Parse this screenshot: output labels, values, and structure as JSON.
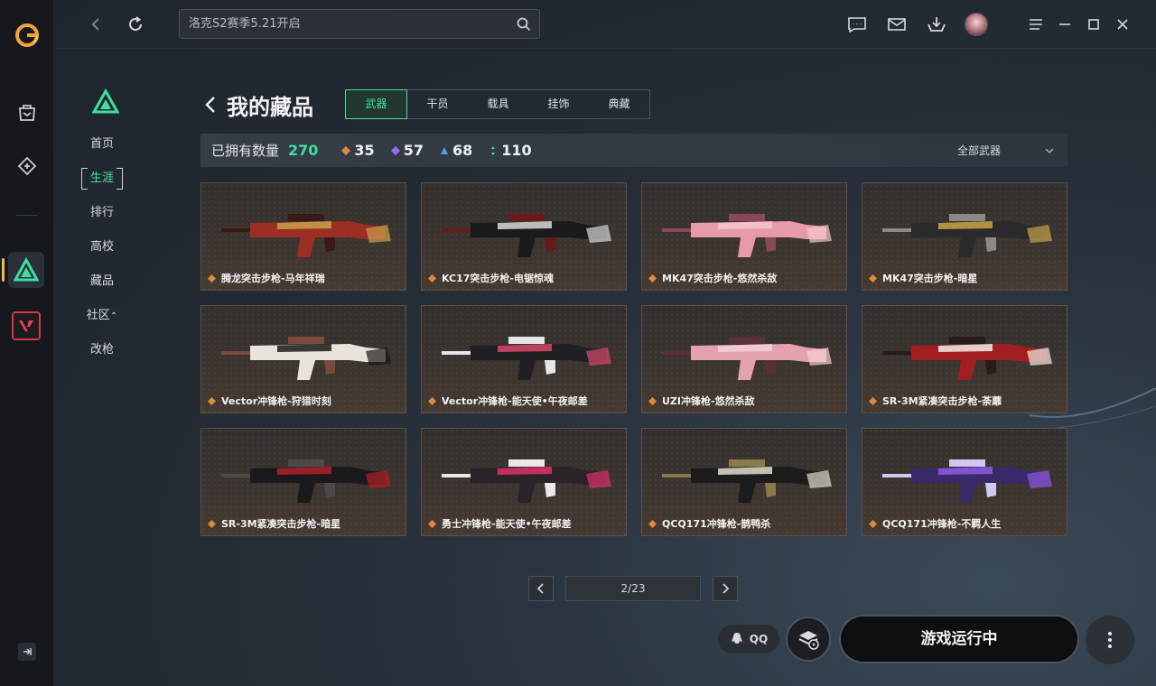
{
  "search": {
    "placeholder": "洛克S2赛季5.21开启"
  },
  "nav": {
    "items": [
      {
        "label": "首页",
        "active": false
      },
      {
        "label": "生涯",
        "active": true
      },
      {
        "label": "排行",
        "active": false
      },
      {
        "label": "高校",
        "active": false
      },
      {
        "label": "藏品",
        "active": false
      },
      {
        "label": "社区",
        "active": false
      },
      {
        "label": "改枪",
        "active": false
      }
    ]
  },
  "header": {
    "title": "我的藏品"
  },
  "tabs": [
    {
      "label": "武器",
      "active": true
    },
    {
      "label": "干员",
      "active": false
    },
    {
      "label": "载具",
      "active": false
    },
    {
      "label": "挂饰",
      "active": false
    },
    {
      "label": "典藏",
      "active": false
    }
  ],
  "stats": {
    "owned_label": "已拥有数量",
    "owned_total": "270",
    "tiers": [
      {
        "value": "35",
        "color": "#e08a3c"
      },
      {
        "value": "57",
        "color": "#9a6cf0"
      },
      {
        "value": "68",
        "color": "#4aa3f0"
      },
      {
        "value": "110",
        "color": "#3ee0a0"
      }
    ],
    "filter_label": "全部武器"
  },
  "items": [
    {
      "name": "腾龙突击步枪-马年祥瑞",
      "colors": [
        "#9c2e24",
        "#c9a14a",
        "#3a1a16"
      ]
    },
    {
      "name": "KC17突击步枪-电锯惊魂",
      "colors": [
        "#1b1b1d",
        "#d8d8d8",
        "#6a1a1a"
      ]
    },
    {
      "name": "MK47突击步枪-悠然杀敌",
      "colors": [
        "#e79aa8",
        "#f4c7cf",
        "#8a4a55"
      ]
    },
    {
      "name": "MK47突击步枪-暗星",
      "colors": [
        "#2a2a2c",
        "#c7a548",
        "#8a8a8a"
      ]
    },
    {
      "name": "Vector冲锋枪-狩猎时刻",
      "colors": [
        "#e8e4dc",
        "#1a1a1a",
        "#7a4a3a"
      ]
    },
    {
      "name": "Vector冲锋枪-能天使•午夜邮差",
      "colors": [
        "#202024",
        "#d84a6a",
        "#e6e6e6"
      ]
    },
    {
      "name": "UZI冲锋枪-悠然杀敌",
      "colors": [
        "#e3a2ae",
        "#f4d0d6",
        "#5a3038"
      ]
    },
    {
      "name": "SR-3M紧凑突击步枪-荼蘼",
      "colors": [
        "#a31e22",
        "#f1ece6",
        "#2a1a1a"
      ]
    },
    {
      "name": "SR-3M紧凑突击步枪-暗星",
      "colors": [
        "#1a1a1c",
        "#b3202a",
        "#4a4a4a"
      ]
    },
    {
      "name": "勇士冲锋枪-能天使•午夜邮差",
      "colors": [
        "#2a2428",
        "#e0306a",
        "#e8e8e8"
      ]
    },
    {
      "name": "QCQ171冲锋枪-鹊鸭杀",
      "colors": [
        "#1c1c1c",
        "#e0dccd",
        "#8a7a4a"
      ]
    },
    {
      "name": "QCQ171冲锋枪-不羁人生",
      "colors": [
        "#3a2a6a",
        "#8e5ae0",
        "#d0c8f0"
      ]
    }
  ],
  "pagination": {
    "page": "2/23"
  },
  "bottom": {
    "qq_label": "QQ",
    "run_label": "游戏运行中"
  }
}
